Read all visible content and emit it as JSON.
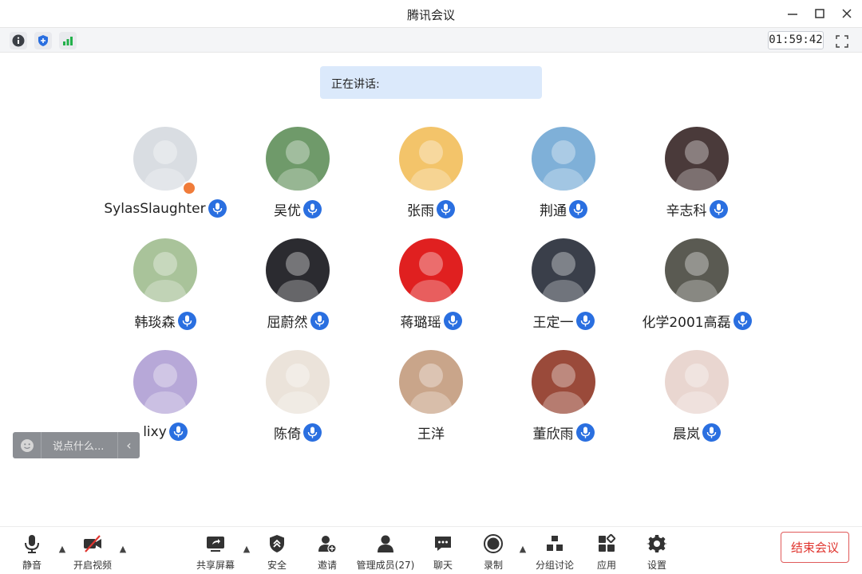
{
  "window": {
    "title": "腾讯会议",
    "minimize_icon": "minimize-icon",
    "maximize_icon": "maximize-icon",
    "close_icon": "close-icon"
  },
  "infobar": {
    "icons": [
      "info-icon",
      "shield-icon",
      "signal-icon"
    ],
    "timer": "01:59:42",
    "fullscreen_icon": "fullscreen-icon"
  },
  "speaking": {
    "label": "正在讲话:"
  },
  "participants": [
    {
      "name": "SylasSlaughter",
      "mic": true,
      "host": true,
      "avatar_color": "#d9dde2"
    },
    {
      "name": "吴优",
      "mic": true,
      "avatar_color": "#6f9a6a"
    },
    {
      "name": "张雨",
      "mic": true,
      "avatar_color": "#f3c46a"
    },
    {
      "name": "荆通",
      "mic": true,
      "avatar_color": "#7fb0d8"
    },
    {
      "name": "辛志科",
      "mic": true,
      "avatar_color": "#4a3a3a"
    },
    {
      "name": "韩琰森",
      "mic": true,
      "avatar_color": "#a9c39a"
    },
    {
      "name": "屈蔚然",
      "mic": true,
      "avatar_color": "#2b2b30"
    },
    {
      "name": "蒋璐瑶",
      "mic": true,
      "avatar_color": "#e02020"
    },
    {
      "name": "王定一",
      "mic": true,
      "avatar_color": "#3a3f4a"
    },
    {
      "name": "化学2001高磊",
      "mic": true,
      "avatar_color": "#5a5a52"
    },
    {
      "name": "lixy",
      "mic": true,
      "avatar_color": "#b7a8d8"
    },
    {
      "name": "陈倚",
      "mic": true,
      "avatar_color": "#ebe3da"
    },
    {
      "name": "王洋",
      "mic": false,
      "avatar_color": "#c9a58a"
    },
    {
      "name": "董欣雨",
      "mic": true,
      "avatar_color": "#9a4a3a"
    },
    {
      "name": "晨岚",
      "mic": true,
      "avatar_color": "#e9d6d0"
    }
  ],
  "chat": {
    "placeholder": "说点什么...",
    "emoji_icon": "emoji-icon",
    "collapse_glyph": "‹"
  },
  "toolbar": {
    "mute": "静音",
    "video": "开启视频",
    "share": "共享屏幕",
    "security": "安全",
    "invite": "邀请",
    "members": "管理成员(27)",
    "chat": "聊天",
    "record": "录制",
    "breakout": "分组讨论",
    "apps": "应用",
    "settings": "设置",
    "end": "结束会议",
    "end_color": "#e0352f"
  }
}
